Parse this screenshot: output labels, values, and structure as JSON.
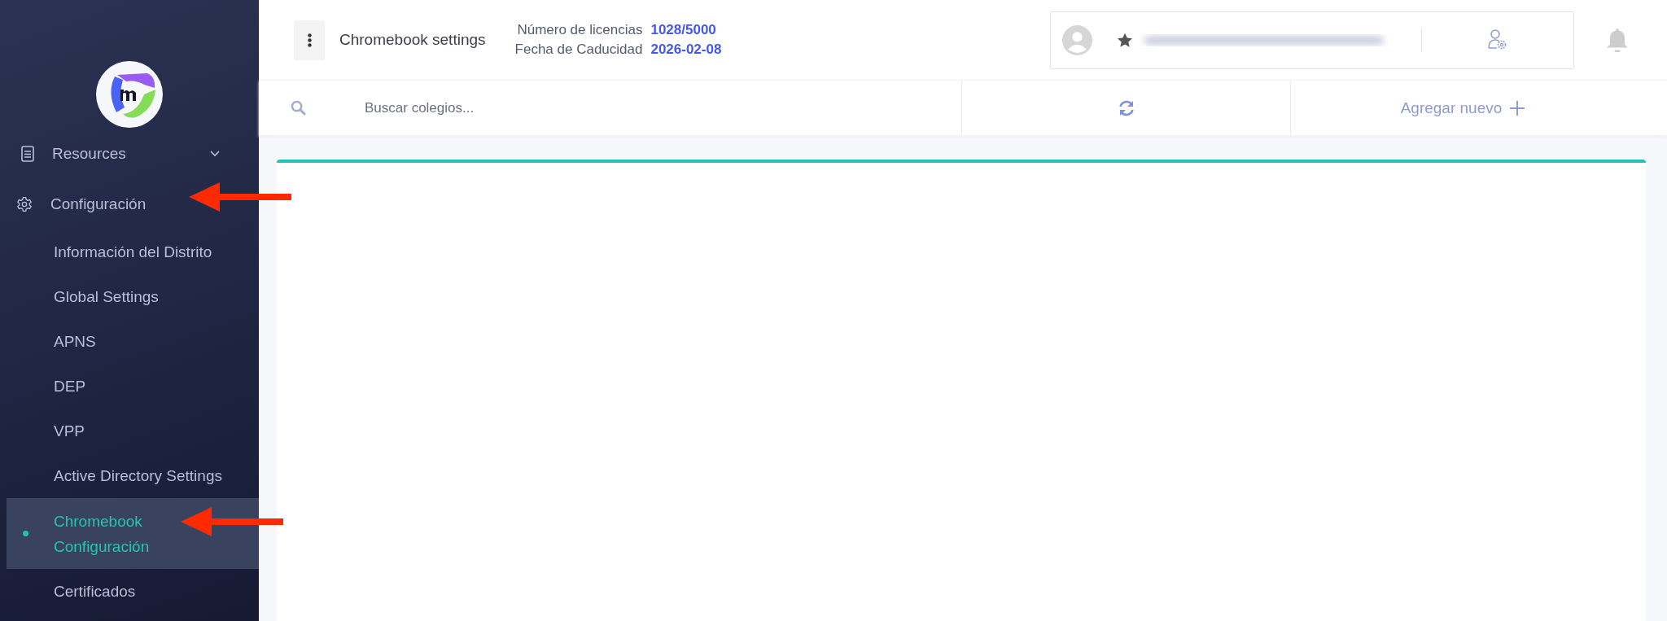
{
  "sidebar": {
    "sections": [
      {
        "label": "Resources",
        "expanded": false
      },
      {
        "label": "Configuración",
        "children": [
          {
            "label": "Información del Distrito",
            "selected": false
          },
          {
            "label": "Global Settings",
            "selected": false
          },
          {
            "label": "APNS",
            "selected": false
          },
          {
            "label": "DEP",
            "selected": false
          },
          {
            "label": "VPP",
            "selected": false
          },
          {
            "label": "Active Directory Settings",
            "selected": false
          },
          {
            "label": "Chromebook Configuración",
            "selected": true
          },
          {
            "label": "Certificados",
            "selected": false
          }
        ]
      }
    ]
  },
  "header": {
    "title": "Chromebook settings",
    "license_label": "Número de licencias",
    "license_value": "1028/5000",
    "expiry_label": "Fecha de Caducidad",
    "expiry_value": "2026-02-08"
  },
  "toolbar": {
    "search": {
      "placeholder": "Buscar colegios..."
    },
    "add_button": "Agregar nuevo"
  }
}
